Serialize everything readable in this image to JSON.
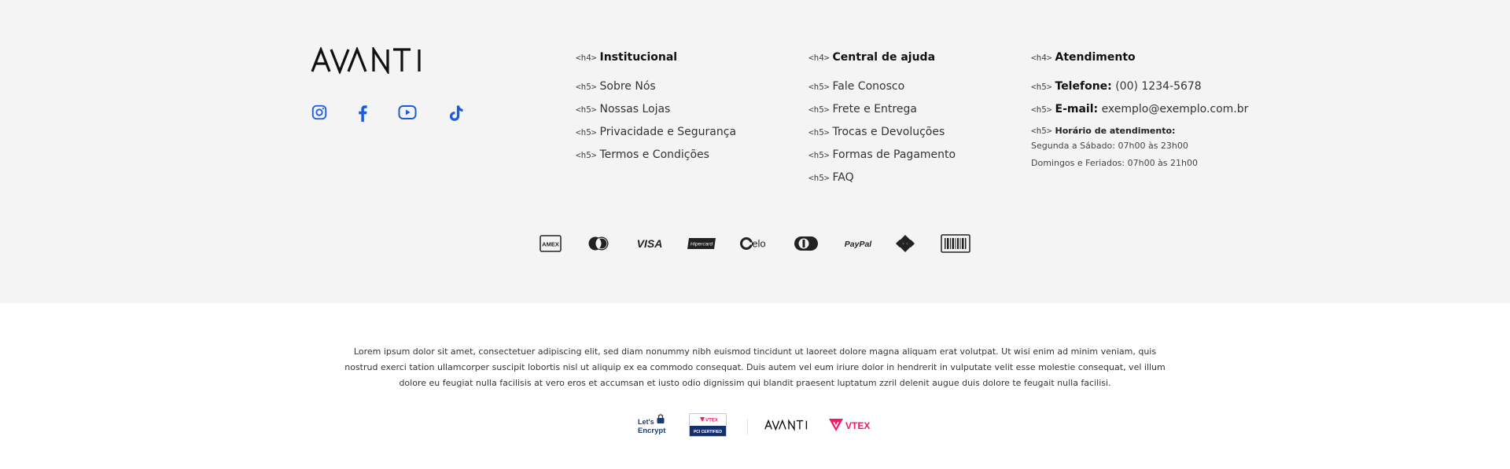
{
  "brand": {
    "name": "AVANTI"
  },
  "social": [
    {
      "name": "instagram-icon",
      "color": "#1a5ce0"
    },
    {
      "name": "facebook-icon",
      "color": "#1a5ce0"
    },
    {
      "name": "youtube-icon",
      "color": "#1a5ce0"
    },
    {
      "name": "tiktok-icon",
      "color": "#1a5ce0"
    }
  ],
  "columns": {
    "institucional": {
      "tag": "<h4>",
      "title": "Institucional",
      "items": [
        {
          "tag": "<h5>",
          "label": "Sobre Nós"
        },
        {
          "tag": "<h5>",
          "label": "Nossas Lojas"
        },
        {
          "tag": "<h5>",
          "label": "Privacidade e Segurança"
        },
        {
          "tag": "<h5>",
          "label": "Termos e Condições"
        }
      ]
    },
    "ajuda": {
      "tag": "<h4>",
      "title": "Central de ajuda",
      "items": [
        {
          "tag": "<h5>",
          "label": "Fale Conosco"
        },
        {
          "tag": "<h5>",
          "label": "Frete e Entrega"
        },
        {
          "tag": "<h5>",
          "label": "Trocas e Devoluções"
        },
        {
          "tag": "<h5>",
          "label": "Formas de Pagamento"
        },
        {
          "tag": "<h5>",
          "label": "FAQ"
        }
      ]
    },
    "atendimento": {
      "tag": "<h4>",
      "title": "Atendimento",
      "phone": {
        "tag": "<h5>",
        "label": "Telefone:",
        "value": "(00) 1234-5678"
      },
      "email": {
        "tag": "<h5>",
        "label": "E-mail:",
        "value": "exemplo@exemplo.com.br"
      },
      "hours": {
        "tag": "<h5>",
        "label": "Horário de atendimento:",
        "lines": [
          "Segunda a Sábado: 07h00 às 23h00",
          "Domingos e Feriados:  07h00 às 21h00"
        ]
      }
    }
  },
  "payments": [
    "AMEX",
    "Mastercard",
    "VISA",
    "Hipercard",
    "elo",
    "Diners",
    "PayPal",
    "Pix",
    "Boleto"
  ],
  "payment_text": {
    "amex": "AMEX",
    "visa": "VISA",
    "hipercard": "Hipercard",
    "elo": "elo",
    "paypal": "PayPal"
  },
  "legal_text": "Lorem ipsum dolor sit amet, consectetuer adipiscing elit, sed diam nonummy nibh euismod tincidunt ut laoreet dolore magna aliquam erat volutpat. Ut wisi enim ad minim veniam, quis nostrud exerci tation ullamcorper suscipit lobortis nisl ut aliquip ex ea commodo consequat. Duis autem vel eum iriure dolor in hendrerit in vulputate velit esse molestie consequat, vel illum dolore eu feugiat nulla facilisis at vero eros et accumsan et iusto odio dignissim qui blandit praesent luptatum zzril delenit augue duis dolore te feugait nulla facilisi.",
  "badges": {
    "letsencrypt_line1": "Let's",
    "letsencrypt_line2": "Encrypt",
    "vtex_pci_top": "VTEX",
    "vtex_pci_bottom": "PCI CERTIFIED",
    "avanti": "AVANTI",
    "vtex": "VTEX"
  },
  "colors": {
    "footer_bg": "#f4f4f4",
    "social": "#1a5ce0",
    "vtex": "#f71963",
    "pci_blue": "#142f6b"
  }
}
